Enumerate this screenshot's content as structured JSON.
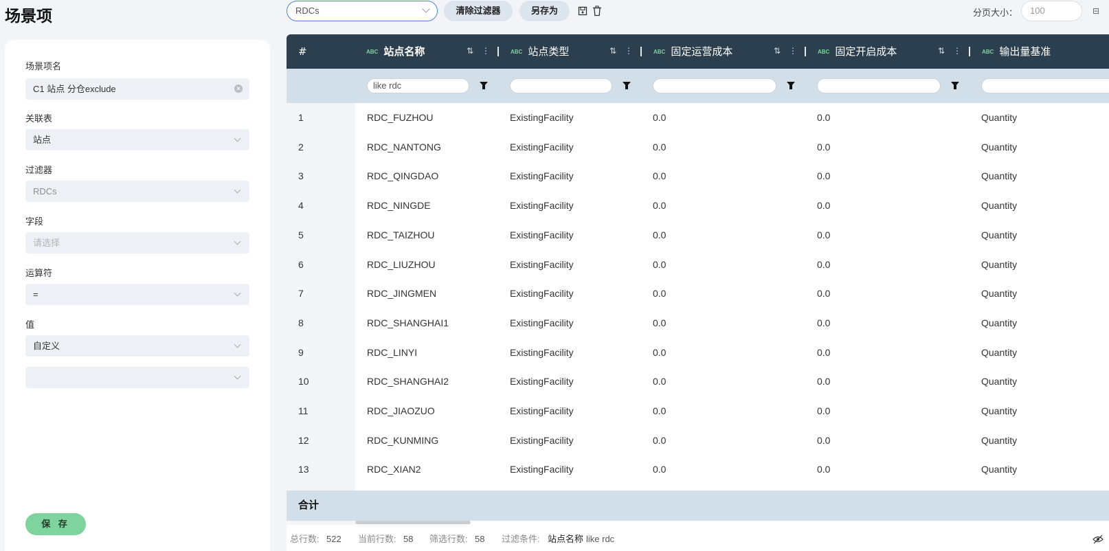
{
  "page": {
    "title": "场景项"
  },
  "toolbar": {
    "filter_value": "RDCs",
    "clear_filter_label": "清除过滤器",
    "save_as_label": "另存为",
    "page_size_label": "分页大小：",
    "page_size_value": "100"
  },
  "form": {
    "name_label": "场景项名",
    "name_value": "C1 站点 分仓exclude",
    "table_label": "关联表",
    "table_value": "站点",
    "filter_label": "过滤器",
    "filter_value": "RDCs",
    "field_label": "字段",
    "field_placeholder": "请选择",
    "operator_label": "运算符",
    "operator_value": "=",
    "value_label": "值",
    "value_value": "自定义",
    "extra_value": "",
    "save_label": "保 存"
  },
  "grid": {
    "columns": [
      {
        "type": "#",
        "label": "#"
      },
      {
        "type": "ABC",
        "label": "站点名称",
        "filter": "like rdc"
      },
      {
        "type": "ABC",
        "label": "站点类型",
        "filter": ""
      },
      {
        "type": "ABC",
        "label": "固定运营成本",
        "filter": ""
      },
      {
        "type": "ABC",
        "label": "固定开启成本",
        "filter": ""
      },
      {
        "type": "ABC",
        "label": "输出量基准",
        "filter": ""
      }
    ],
    "rows": [
      [
        "1",
        "RDC_FUZHOU",
        "ExistingFacility",
        "0.0",
        "0.0",
        "Quantity"
      ],
      [
        "2",
        "RDC_NANTONG",
        "ExistingFacility",
        "0.0",
        "0.0",
        "Quantity"
      ],
      [
        "3",
        "RDC_QINGDAO",
        "ExistingFacility",
        "0.0",
        "0.0",
        "Quantity"
      ],
      [
        "4",
        "RDC_NINGDE",
        "ExistingFacility",
        "0.0",
        "0.0",
        "Quantity"
      ],
      [
        "5",
        "RDC_TAIZHOU",
        "ExistingFacility",
        "0.0",
        "0.0",
        "Quantity"
      ],
      [
        "6",
        "RDC_LIUZHOU",
        "ExistingFacility",
        "0.0",
        "0.0",
        "Quantity"
      ],
      [
        "7",
        "RDC_JINGMEN",
        "ExistingFacility",
        "0.0",
        "0.0",
        "Quantity"
      ],
      [
        "8",
        "RDC_SHANGHAI1",
        "ExistingFacility",
        "0.0",
        "0.0",
        "Quantity"
      ],
      [
        "9",
        "RDC_LINYI",
        "ExistingFacility",
        "0.0",
        "0.0",
        "Quantity"
      ],
      [
        "10",
        "RDC_SHANGHAI2",
        "ExistingFacility",
        "0.0",
        "0.0",
        "Quantity"
      ],
      [
        "11",
        "RDC_JIAOZUO",
        "ExistingFacility",
        "0.0",
        "0.0",
        "Quantity"
      ],
      [
        "12",
        "RDC_KUNMING",
        "ExistingFacility",
        "0.0",
        "0.0",
        "Quantity"
      ],
      [
        "13",
        "RDC_XIAN2",
        "ExistingFacility",
        "0.0",
        "0.0",
        "Quantity"
      ]
    ],
    "total_label": "合计"
  },
  "status": {
    "total_rows_label": "总行数:",
    "total_rows": "522",
    "current_rows_label": "当前行数:",
    "current_rows": "58",
    "filtered_rows_label": "筛选行数:",
    "filtered_rows": "58",
    "condition_label": "过滤条件:",
    "condition_field": "站点名称",
    "condition_expr": "like rdc"
  },
  "icons": [
    "chevron-down-icon",
    "save-icon",
    "delete-icon",
    "sort-icon",
    "more-icon",
    "filter-icon",
    "hide-icon",
    "clear-icon"
  ]
}
